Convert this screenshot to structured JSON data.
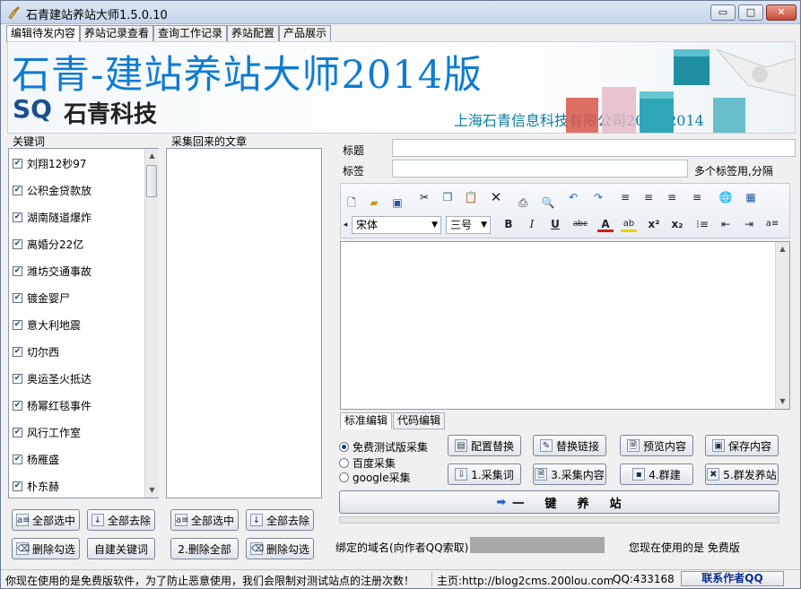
{
  "window": {
    "title": "石青建站养站大师1.5.0.10",
    "controls": {
      "minimize": "▭",
      "maximize": "□",
      "close": "✕"
    }
  },
  "tabs": [
    {
      "label": "编辑待发内容",
      "active": true
    },
    {
      "label": "养站记录查看",
      "active": false
    },
    {
      "label": "查询工作记录",
      "active": false
    },
    {
      "label": "养站配置",
      "active": false
    },
    {
      "label": "产品展示",
      "active": false
    }
  ],
  "banner": {
    "title": "石青-建站养站大师2014版",
    "logo_sq": "SQ",
    "logo_name": "石青科技",
    "company": "上海石青信息科技有限公司2008-2014"
  },
  "keywords": {
    "label": "关键词",
    "items": [
      {
        "text": "刘翔12秒97",
        "checked": true
      },
      {
        "text": "公积金贷款放",
        "checked": true
      },
      {
        "text": "湖南隧道爆炸",
        "checked": true
      },
      {
        "text": "离婚分22亿",
        "checked": true
      },
      {
        "text": "潍坊交通事故",
        "checked": true
      },
      {
        "text": "镀金婴尸",
        "checked": true
      },
      {
        "text": "意大利地震",
        "checked": true
      },
      {
        "text": "切尔西",
        "checked": true
      },
      {
        "text": "奥运圣火抵达",
        "checked": true
      },
      {
        "text": "杨幂红毯事件",
        "checked": true
      },
      {
        "text": "风行工作室",
        "checked": true
      },
      {
        "text": "杨雁盛",
        "checked": true
      },
      {
        "text": "朴东赫",
        "checked": true
      }
    ],
    "buttons": {
      "select_all": "全部选中",
      "deselect_all": "全部去除",
      "delete_checked": "删除勾选",
      "custom_keywords": "自建关键词"
    }
  },
  "articles": {
    "label": "采集回来的文章",
    "buttons": {
      "select_all": "全部选中",
      "deselect_all": "全部去除",
      "delete_all": "2.删除全部",
      "delete_checked": "删除勾选"
    }
  },
  "editor": {
    "title_label": "标题",
    "title_value": "",
    "tags_label": "标签",
    "tags_value": "",
    "tags_hint": "多个标签用,分隔",
    "font_family": "宋体",
    "font_size": "三号",
    "tabs": [
      {
        "label": "标准编辑",
        "active": true
      },
      {
        "label": "代码编辑",
        "active": false
      }
    ],
    "body": ""
  },
  "collection_source": {
    "options": [
      {
        "label": "免费测试版采集",
        "selected": true
      },
      {
        "label": "百度采集",
        "selected": false
      },
      {
        "label": "google采集",
        "selected": false
      }
    ]
  },
  "actions": {
    "config_replace": "配置替换",
    "replace_links": "替换链接",
    "preview": "预览内容",
    "save": "保存内容",
    "step1": "1.采集词",
    "step3": "3.采集内容",
    "step4": "4.群建",
    "step5": "5.群发养站",
    "one_click": "一    键    养    站"
  },
  "domain_label": "绑定的域名(向作者QQ索取)",
  "version_notice": "您现在使用的是 免费版",
  "status": {
    "notice": "你现在使用的是免费版软件，为了防止恶意使用，我们会限制对测试站点的注册次数！",
    "homepage": "主页:http://blog2cms.200lou.com",
    "qq": "QQ:433168",
    "contact": "联系作者QQ"
  },
  "colors": {
    "banner_title": "#0f7bd4",
    "company_text": "#0a7fa0",
    "logo_blue": "#1d4f8f"
  }
}
